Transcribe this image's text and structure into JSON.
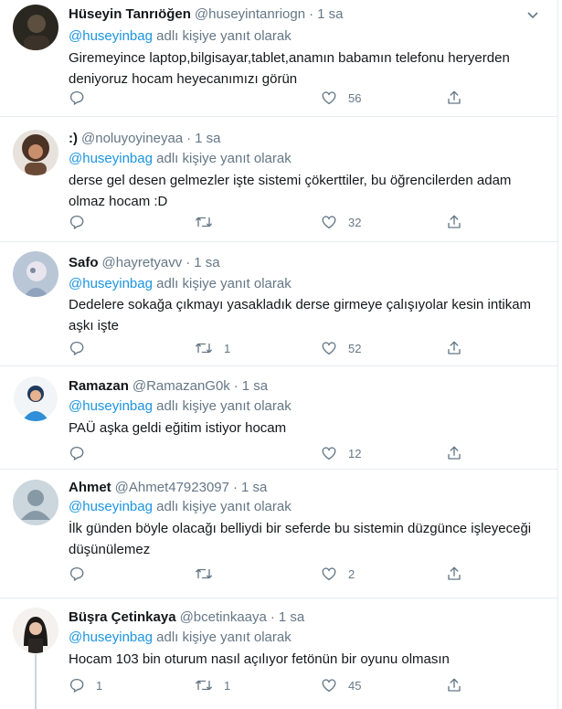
{
  "colors": {
    "accent": "#1b95e0",
    "muted": "#657786",
    "text": "#14171a",
    "divider": "#e6ecf0"
  },
  "tweets": [
    {
      "name": "Hüseyin Tanrıöğen",
      "handle": "@huseyintanriogn",
      "dot": "·",
      "time": "1 sa",
      "mention": "@huseyinbag",
      "reply_suffix": "adlı kişiye yanıt olarak",
      "text_lines": [
        "Giremeyince laptop,bilgisayar,tablet,anamın babamın telefonu heryerden",
        "deniyoruz hocam heyecanımızı görün"
      ],
      "replies": "",
      "retweets": "",
      "likes": "56",
      "retweet_icon": false
    },
    {
      "name": ":)",
      "handle": "@noluyoyineyaa",
      "dot": "·",
      "time": "1 sa",
      "mention": "@huseyinbag",
      "reply_suffix": "adlı kişiye yanıt olarak",
      "text_lines": [
        "derse gel desen gelmezler işte sistemi çökerttiler, bu öğrencilerden adam",
        "olmaz hocam :D"
      ],
      "replies": "",
      "retweets": "",
      "likes": "32",
      "retweet_icon": true
    },
    {
      "name": "Safo",
      "handle": "@hayretyavv",
      "dot": "·",
      "time": "1 sa",
      "mention": "@huseyinbag",
      "reply_suffix": "adlı kişiye yanıt olarak",
      "text_lines": [
        "Dedelere sokağa çıkmayı yasakladık derse girmeye çalışıyolar kesin intikam",
        "aşkı işte"
      ],
      "replies": "",
      "retweets": "1",
      "likes": "52",
      "retweet_icon": true
    },
    {
      "name": "Ramazan",
      "handle": "@RamazanG0k",
      "dot": "·",
      "time": "1 sa",
      "mention": "@huseyinbag",
      "reply_suffix": "adlı kişiye yanıt olarak",
      "text_lines": [
        "PAÜ aşka geldi eğitim istiyor hocam"
      ],
      "replies": "",
      "retweets": "",
      "likes": "12",
      "retweet_icon": false
    },
    {
      "name": "Ahmet",
      "handle": "@Ahmet47923097",
      "dot": "·",
      "time": "1 sa",
      "mention": "@huseyinbag",
      "reply_suffix": "adlı kişiye yanıt olarak",
      "text_lines": [
        "İlk günden böyle olacağı belliydi bir seferde bu sistemin düzgünce işleyeceği",
        "düşünülemez"
      ],
      "replies": "",
      "retweets": "",
      "likes": "2",
      "retweet_icon": true
    },
    {
      "name": "Büşra Çetinkaya",
      "handle": "@bcetinkaaya",
      "dot": "·",
      "time": "1 sa",
      "mention": "@huseyinbag",
      "reply_suffix": "adlı kişiye yanıt olarak",
      "text_lines": [
        "Hocam 103 bin oturum nasıl açılıyor fetönün bir oyunu olmasın"
      ],
      "replies": "1",
      "retweets": "1",
      "likes": "45",
      "retweet_icon": true
    }
  ]
}
